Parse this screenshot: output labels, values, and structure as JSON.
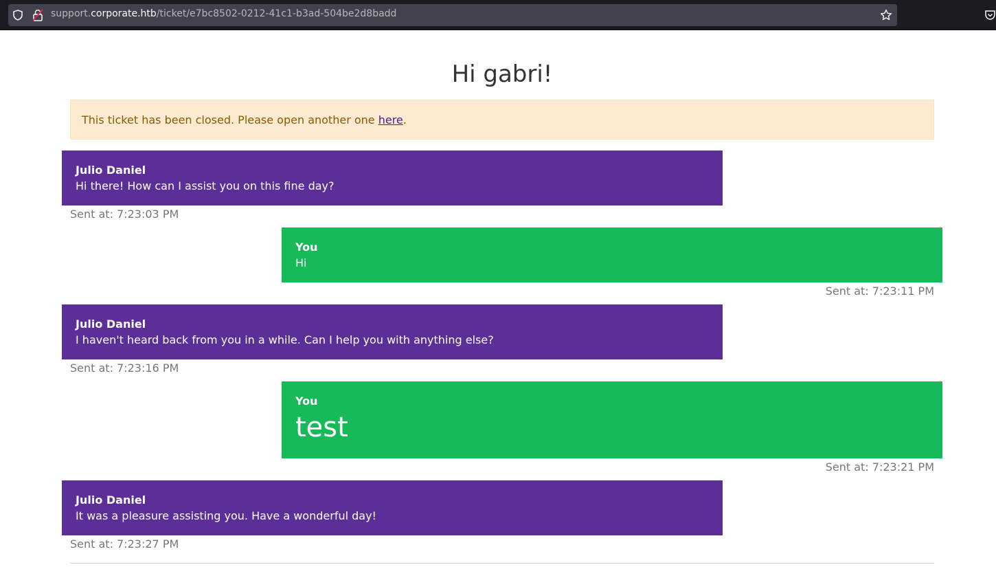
{
  "browser": {
    "url_prefix": "support.",
    "url_host": "corporate.htb",
    "url_path": "/ticket/e7bc8502-0212-41c1-b3ad-504be2d8badd"
  },
  "page": {
    "title": "Hi gabri!",
    "alert": {
      "text": "This ticket has been closed. Please open another one ",
      "link_label": "here",
      "suffix": "."
    }
  },
  "messages": [
    {
      "role": "agent",
      "sender": "Julio Daniel",
      "text": "Hi there! How can I assist you on this fine day?",
      "time": "Sent at: 7:23:03 PM"
    },
    {
      "role": "user",
      "sender": "You",
      "text": "Hi",
      "time": "Sent at: 7:23:11 PM"
    },
    {
      "role": "agent",
      "sender": "Julio Daniel",
      "text": "I haven't heard back from you in a while. Can I help you with anything else?",
      "time": "Sent at: 7:23:16 PM"
    },
    {
      "role": "user",
      "sender": "You",
      "text": "test",
      "time": "Sent at: 7:23:21 PM"
    },
    {
      "role": "agent",
      "sender": "Julio Daniel",
      "text": "It was a pleasure assisting you. Have a wonderful day!",
      "time": "Sent at: 7:23:27 PM"
    }
  ],
  "colors": {
    "agent_bubble": "#5c2f98",
    "user_bubble": "#17ba58",
    "alert_bg": "#fcebd0",
    "alert_text": "#8a5a00"
  },
  "icons": [
    "shield-icon",
    "lock-icon",
    "star-icon",
    "pocket-icon"
  ]
}
